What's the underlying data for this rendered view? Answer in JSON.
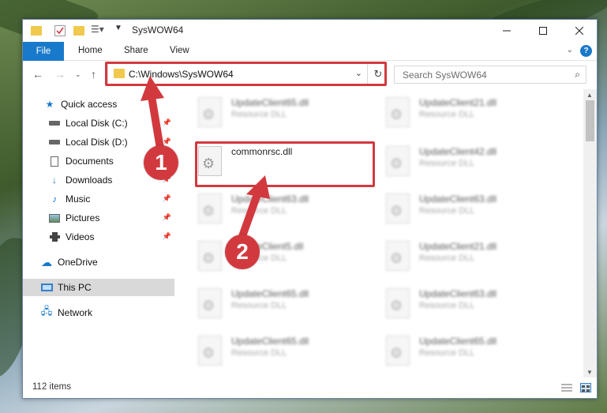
{
  "window": {
    "title": "SysWOW64"
  },
  "ribbon": {
    "file_label": "File",
    "tabs": [
      "Home",
      "Share",
      "View"
    ],
    "help_label": "?"
  },
  "nav": {
    "address_path": "C:\\Windows\\SysWOW64",
    "search_placeholder": "Search SysWOW64"
  },
  "sidebar": {
    "items": [
      {
        "label": "Quick access",
        "icon": "star-icon",
        "pinned": false
      },
      {
        "label": "Local Disk (C:)",
        "icon": "drive-icon",
        "pinned": true
      },
      {
        "label": "Local Disk (D:)",
        "icon": "drive-icon",
        "pinned": true
      },
      {
        "label": "Documents",
        "icon": "document-icon",
        "pinned": true
      },
      {
        "label": "Downloads",
        "icon": "download-icon",
        "pinned": true
      },
      {
        "label": "Music",
        "icon": "music-icon",
        "pinned": true
      },
      {
        "label": "Pictures",
        "icon": "pictures-icon",
        "pinned": true
      },
      {
        "label": "Videos",
        "icon": "video-icon",
        "pinned": true
      },
      {
        "label": "OneDrive",
        "icon": "cloud-icon",
        "pinned": false
      },
      {
        "label": "This PC",
        "icon": "computer-icon",
        "pinned": false
      },
      {
        "label": "Network",
        "icon": "network-icon",
        "pinned": false
      }
    ]
  },
  "files": [
    {
      "name": "UpdateClient65.dll",
      "type": "Resource DLL",
      "blurred": true
    },
    {
      "name": "UpdateClient21.dll",
      "type": "Resource DLL",
      "blurred": true
    },
    {
      "name": "commonrsc.dll",
      "type": "",
      "blurred": false
    },
    {
      "name": "UpdateClient42.dll",
      "type": "Resource DLL",
      "blurred": true
    },
    {
      "name": "UpdateClient63.dll",
      "type": "Resource DLL",
      "blurred": true
    },
    {
      "name": "UpdateClient63.dll",
      "type": "Resource DLL",
      "blurred": true
    },
    {
      "name": "UpdateClient5.dll",
      "type": "Resource DLL",
      "blurred": true
    },
    {
      "name": "UpdateClient21.dll",
      "type": "Resource DLL",
      "blurred": true
    },
    {
      "name": "UpdateClient65.dll",
      "type": "Resource DLL",
      "blurred": true
    },
    {
      "name": "UpdateClient63.dll",
      "type": "Resource DLL",
      "blurred": true
    },
    {
      "name": "UpdateClient65.dll",
      "type": "Resource DLL",
      "blurred": true
    },
    {
      "name": "UpdateClient65.dll",
      "type": "Resource DLL",
      "blurred": true
    }
  ],
  "status": {
    "item_count": "112 items"
  },
  "annotations": {
    "step1": "1",
    "step2": "2",
    "highlight_color": "#d2393f"
  },
  "colors": {
    "accent": "#1979ca",
    "selected_bg": "#d9d9d9"
  }
}
